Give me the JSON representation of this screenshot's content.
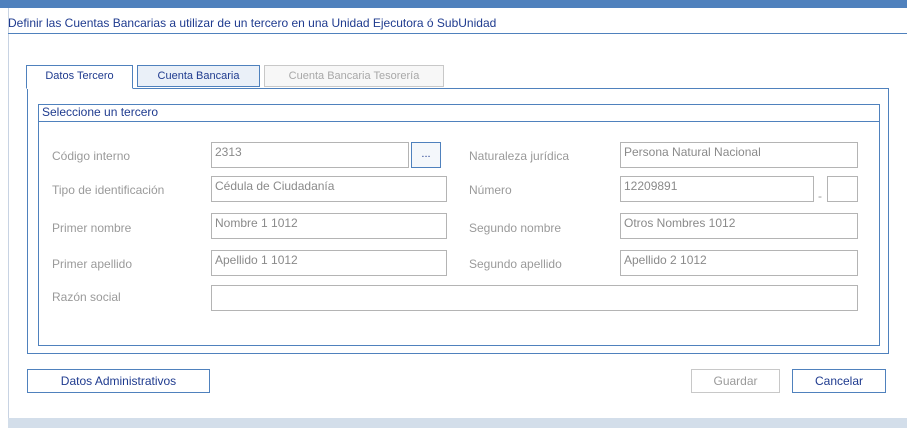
{
  "window": {
    "title": "Definir las Cuentas Bancarias a utilizar de un tercero en una Unidad Ejecutora ó SubUnidad"
  },
  "tabs": [
    {
      "label": "Datos Tercero",
      "state": "active"
    },
    {
      "label": "Cuenta Bancaria",
      "state": "enabled"
    },
    {
      "label": "Cuenta Bancaria Tesorería",
      "state": "disabled"
    }
  ],
  "section": {
    "title": "Seleccione un tercero"
  },
  "fields": {
    "codigo_interno": {
      "label": "Código interno",
      "value": "2313"
    },
    "lookup_button": {
      "label": "..."
    },
    "naturaleza_juridica": {
      "label": "Naturaleza jurídica",
      "value": "Persona Natural Nacional"
    },
    "tipo_identificacion": {
      "label": "Tipo de identificación",
      "value": "Cédula de Ciudadanía"
    },
    "numero": {
      "label": "Número",
      "value": "12209891",
      "separator": "-",
      "check_digit": ""
    },
    "primer_nombre": {
      "label": "Primer nombre",
      "value": "Nombre 1 1012"
    },
    "segundo_nombre": {
      "label": "Segundo nombre",
      "value": "Otros Nombres 1012"
    },
    "primer_apellido": {
      "label": "Primer apellido",
      "value": "Apellido 1 1012"
    },
    "segundo_apellido": {
      "label": "Segundo apellido",
      "value": "Apellido 2 1012"
    },
    "razon_social": {
      "label": "Razón social",
      "value": ""
    }
  },
  "actions": {
    "datos_administrativos": "Datos Administrativos",
    "guardar": "Guardar",
    "cancelar": "Cancelar"
  },
  "colors": {
    "accent": "#4f81bd",
    "title_text": "#1f3b8f"
  }
}
